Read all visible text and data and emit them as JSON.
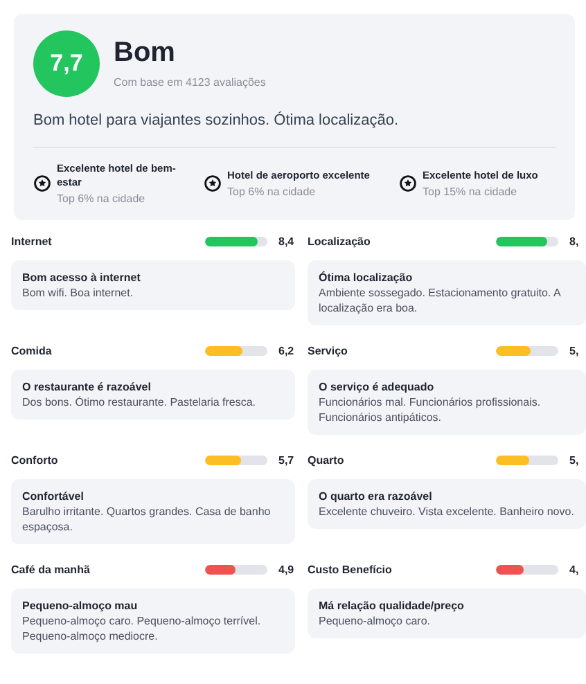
{
  "summary": {
    "score": "7,7",
    "rating": "Bom",
    "based_on": "Com base em 4123 avaliações",
    "description": "Bom hotel para viajantes sozinhos. Ótima localização.",
    "awards": [
      {
        "title": "Excelente hotel de bem-estar",
        "subtitle": "Top 6% na cidade"
      },
      {
        "title": "Hotel de aeroporto excelente",
        "subtitle": "Top 6% na cidade"
      },
      {
        "title": "Excelente hotel de luxo",
        "subtitle": "Top 15% na cidade"
      }
    ]
  },
  "categories": [
    {
      "name": "Internet",
      "level": 0.84,
      "color": "#22c55e",
      "score": "8,4",
      "title": "Bom acesso à internet",
      "text": "Bom wifi. Boa internet."
    },
    {
      "name": "Localização",
      "level": 0.82,
      "color": "#22c55e",
      "score": "8,",
      "title": "Ótima localização",
      "text": "Ambiente sossegado. Estacionamento gratuito. A localização era boa."
    },
    {
      "name": "Comida",
      "level": 0.6,
      "color": "#fbbf24",
      "score": "6,2",
      "title": "O restaurante é razoável",
      "text": "Dos bons. Ótimo restaurante. Pastelaria fresca."
    },
    {
      "name": "Serviço",
      "level": 0.56,
      "color": "#fbbf24",
      "score": "5,",
      "title": "O serviço é adequado",
      "text": "Funcionários mal. Funcionários profissionais. Funcionários antipáticos."
    },
    {
      "name": "Conforto",
      "level": 0.57,
      "color": "#fbbf24",
      "score": "5,7",
      "title": "Confortável",
      "text": "Barulho irritante. Quartos grandes. Casa de banho espaçosa."
    },
    {
      "name": "Quarto",
      "level": 0.54,
      "color": "#fbbf24",
      "score": "5,",
      "title": "O quarto era razoável",
      "text": "Excelente chuveiro. Vista excelente. Banheiro novo."
    },
    {
      "name": "Café da manhã",
      "level": 0.49,
      "color": "#f05252",
      "score": "4,9",
      "title": "Pequeno-almoço mau",
      "text": "Pequeno-almoço caro. Pequeno-almoço terrível. Pequeno-almoço mediocre."
    },
    {
      "name": "Custo Benefício",
      "level": 0.44,
      "color": "#f05252",
      "score": "4,",
      "title": "Má relação qualidade/preço",
      "text": "Pequeno-almoço caro."
    }
  ]
}
